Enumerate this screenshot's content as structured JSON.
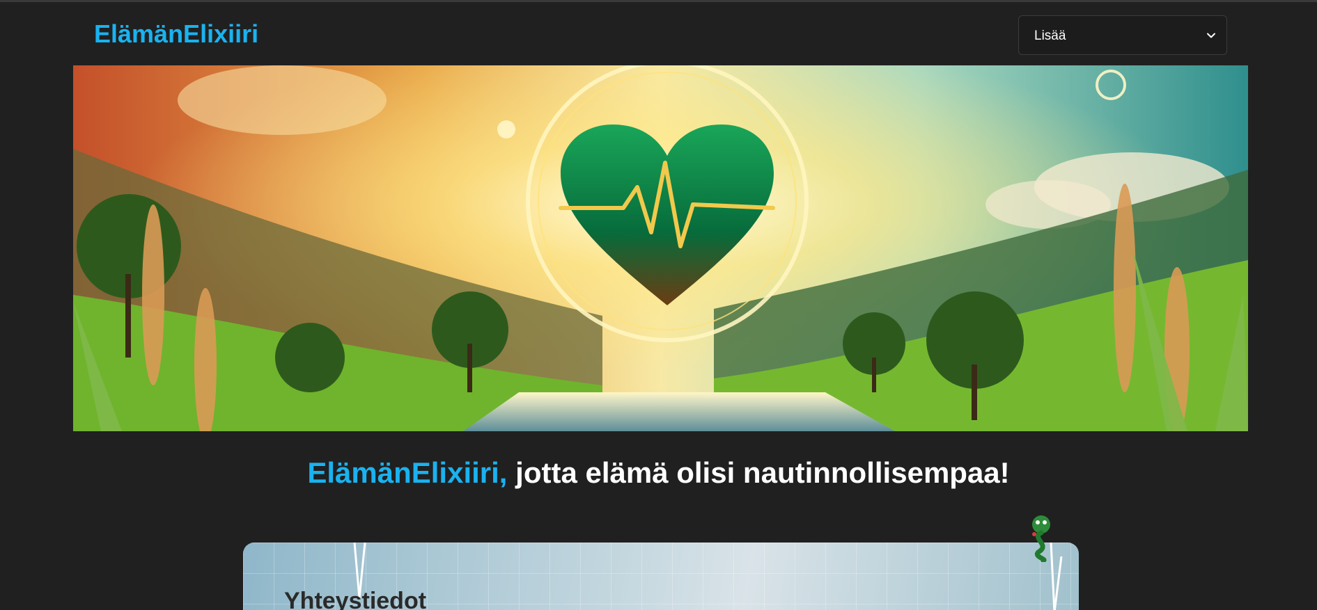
{
  "header": {
    "logo": "ElämänElixiiri",
    "menu_select": {
      "value": "Lisää",
      "icon": "chevron-down-icon"
    }
  },
  "hero": {
    "image": "hero-heart-landscape"
  },
  "tagline": {
    "brand": "ElämänElixiiri,",
    "text": " jotta elämä olisi nautinnollisempaa!"
  },
  "contact_card": {
    "title": "Yhteystiedot"
  },
  "colors": {
    "accent": "#1ab2f0",
    "background": "#202020"
  }
}
